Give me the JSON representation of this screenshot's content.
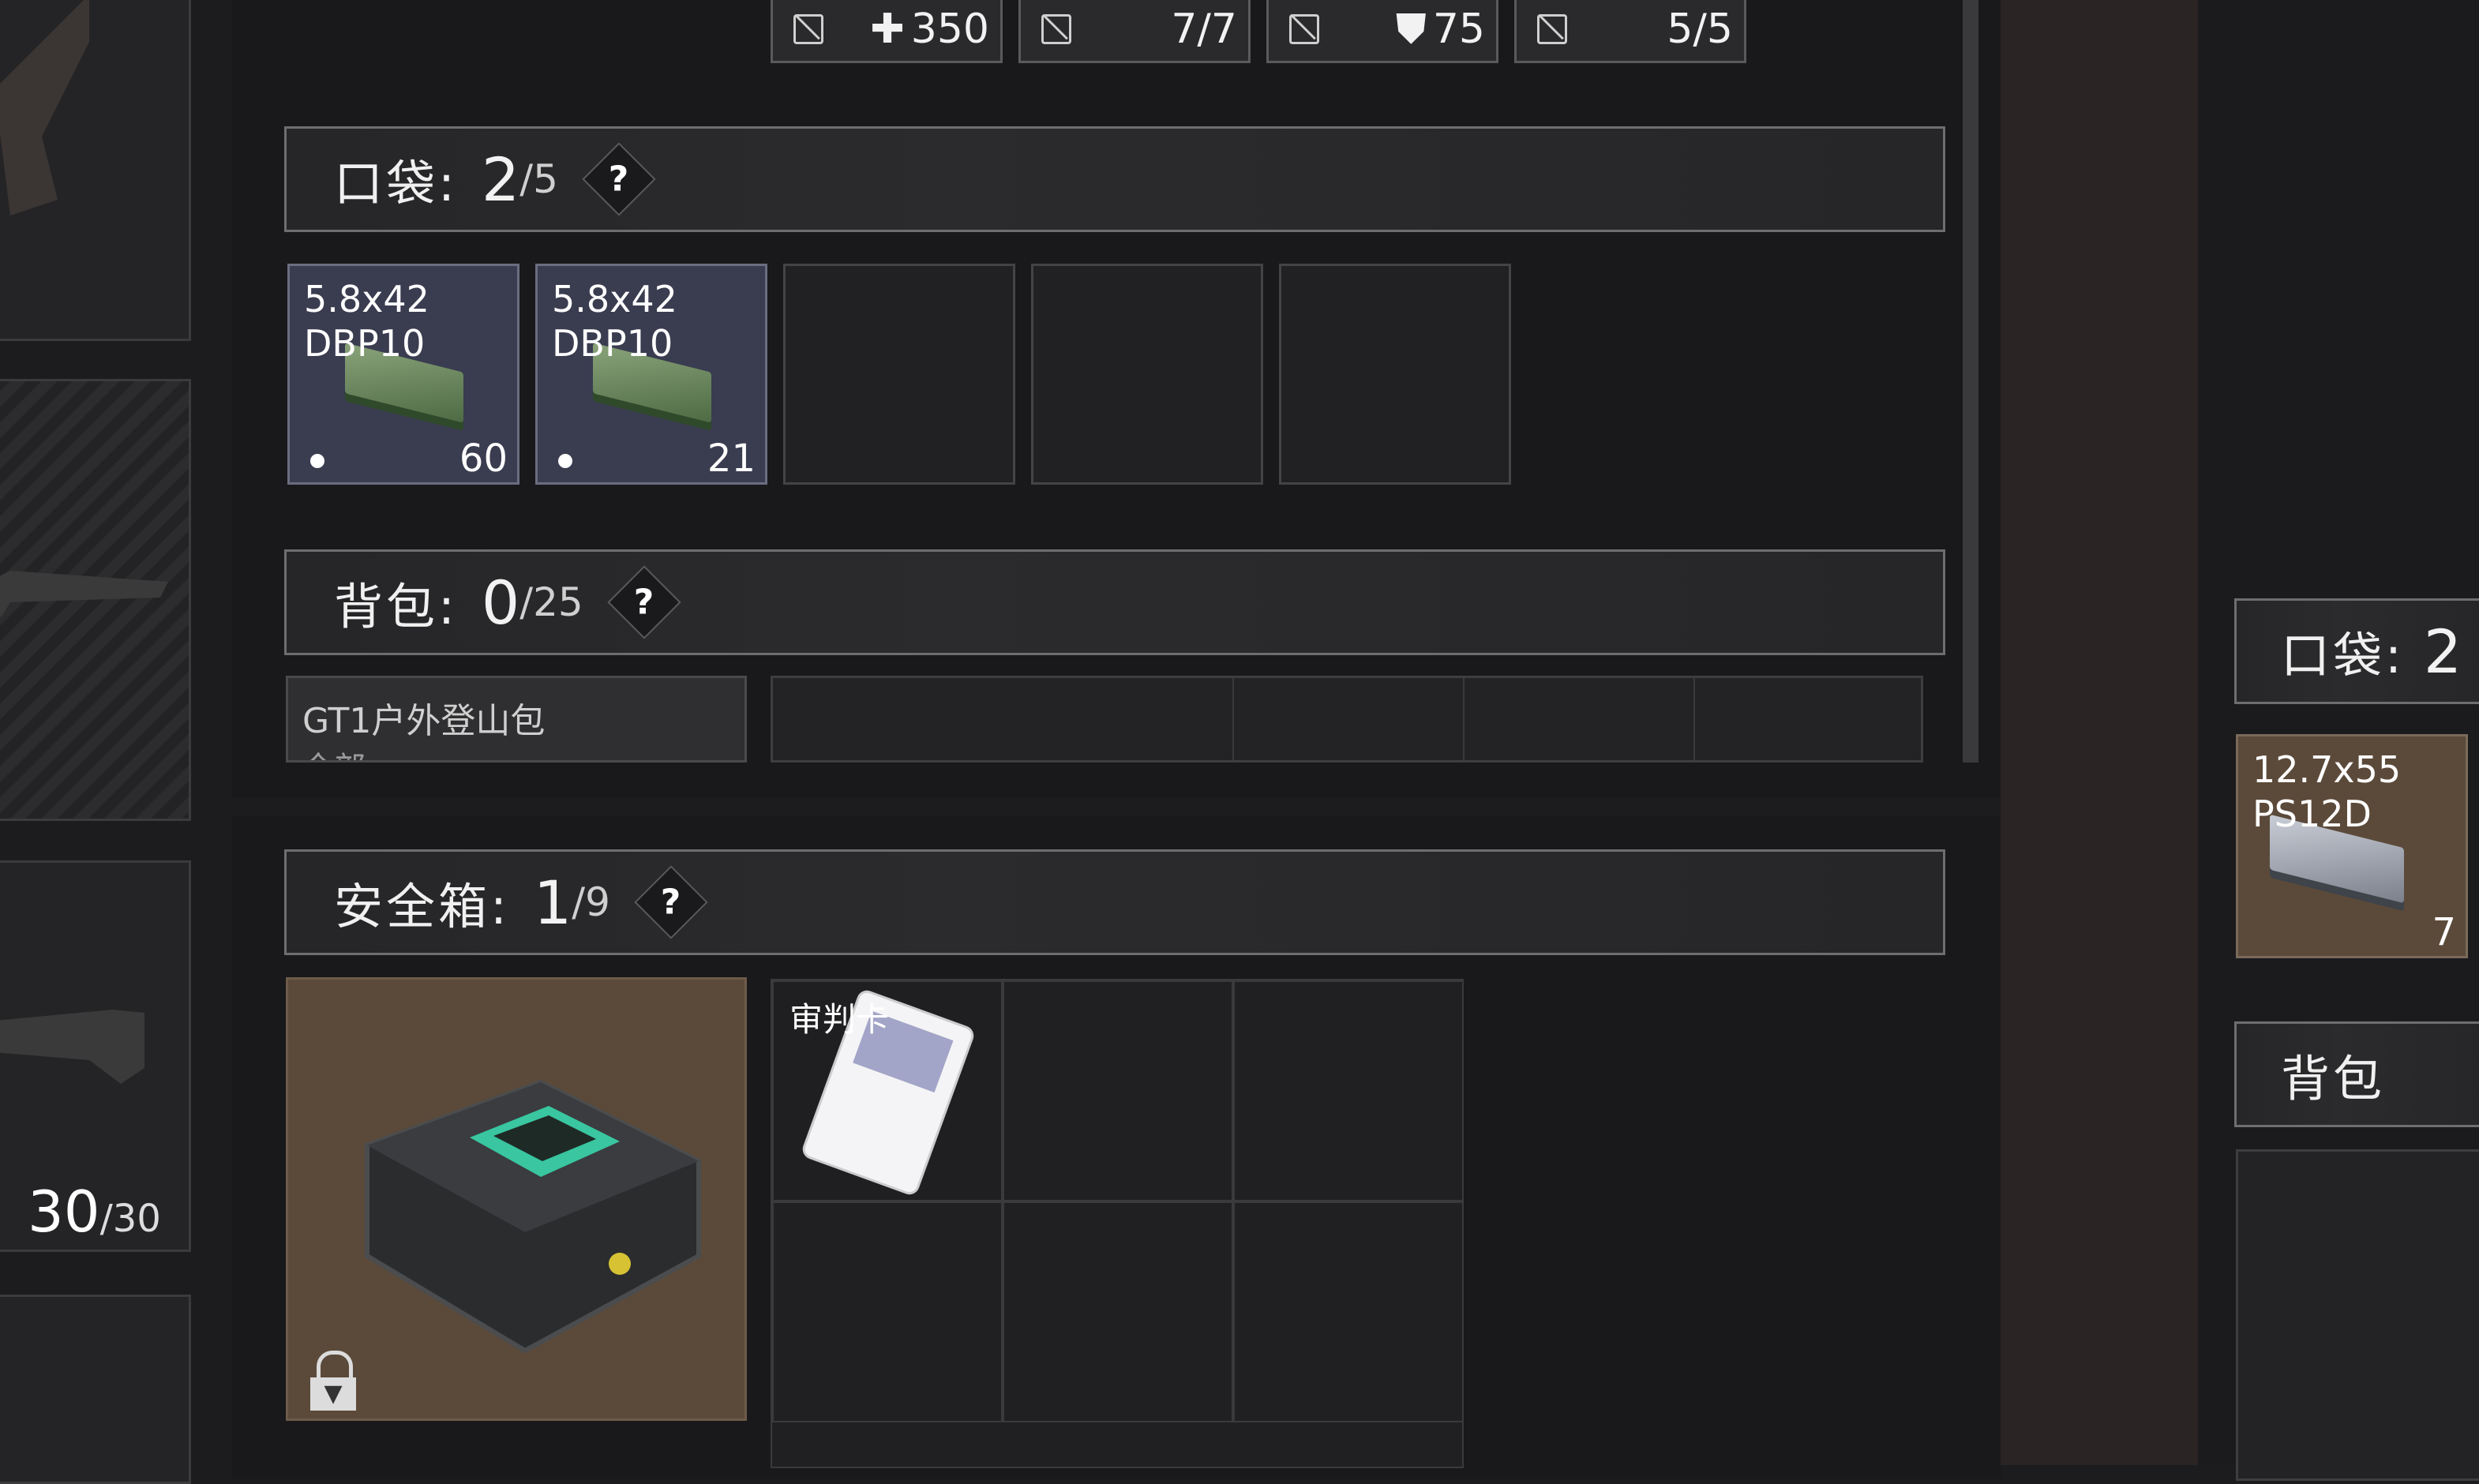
{
  "stats": [
    {
      "icon": "no-image-icon",
      "prefix_icon": "plus-icon",
      "value": "350"
    },
    {
      "icon": "no-image-icon",
      "value": "7/7"
    },
    {
      "icon": "no-image-icon",
      "prefix_icon": "shield-icon",
      "value": "75"
    },
    {
      "icon": "no-image-icon",
      "value": "5/5"
    }
  ],
  "pockets": {
    "title": "口袋:",
    "count": "2",
    "max": "/5",
    "help": "?"
  },
  "pocket_items": [
    {
      "name": "5.8x42\nDBP10",
      "qty": "60"
    },
    {
      "name": "5.8x42\nDBP10",
      "qty": "21"
    }
  ],
  "backpack": {
    "title": "背包:",
    "count": "0",
    "max": "/25",
    "help": "?",
    "item_name": "GT1户外登山包",
    "item_sub": "全部"
  },
  "safebox": {
    "title": "安全箱:",
    "count": "1",
    "max": "/9",
    "help": "?",
    "item_name": "审判卡"
  },
  "left": {
    "ammo_count": "30",
    "ammo_max": "/30"
  },
  "right_panel": {
    "pockets_title": "口袋:",
    "pockets_count": "2",
    "item_name": "12.7x55\nPS12D",
    "item_qty": "7",
    "backpack_title": "背包"
  },
  "colors": {
    "item_bg": "#3a3c50",
    "case_bg": "#5b4a3a",
    "accent_teal": "#39c6a0"
  }
}
